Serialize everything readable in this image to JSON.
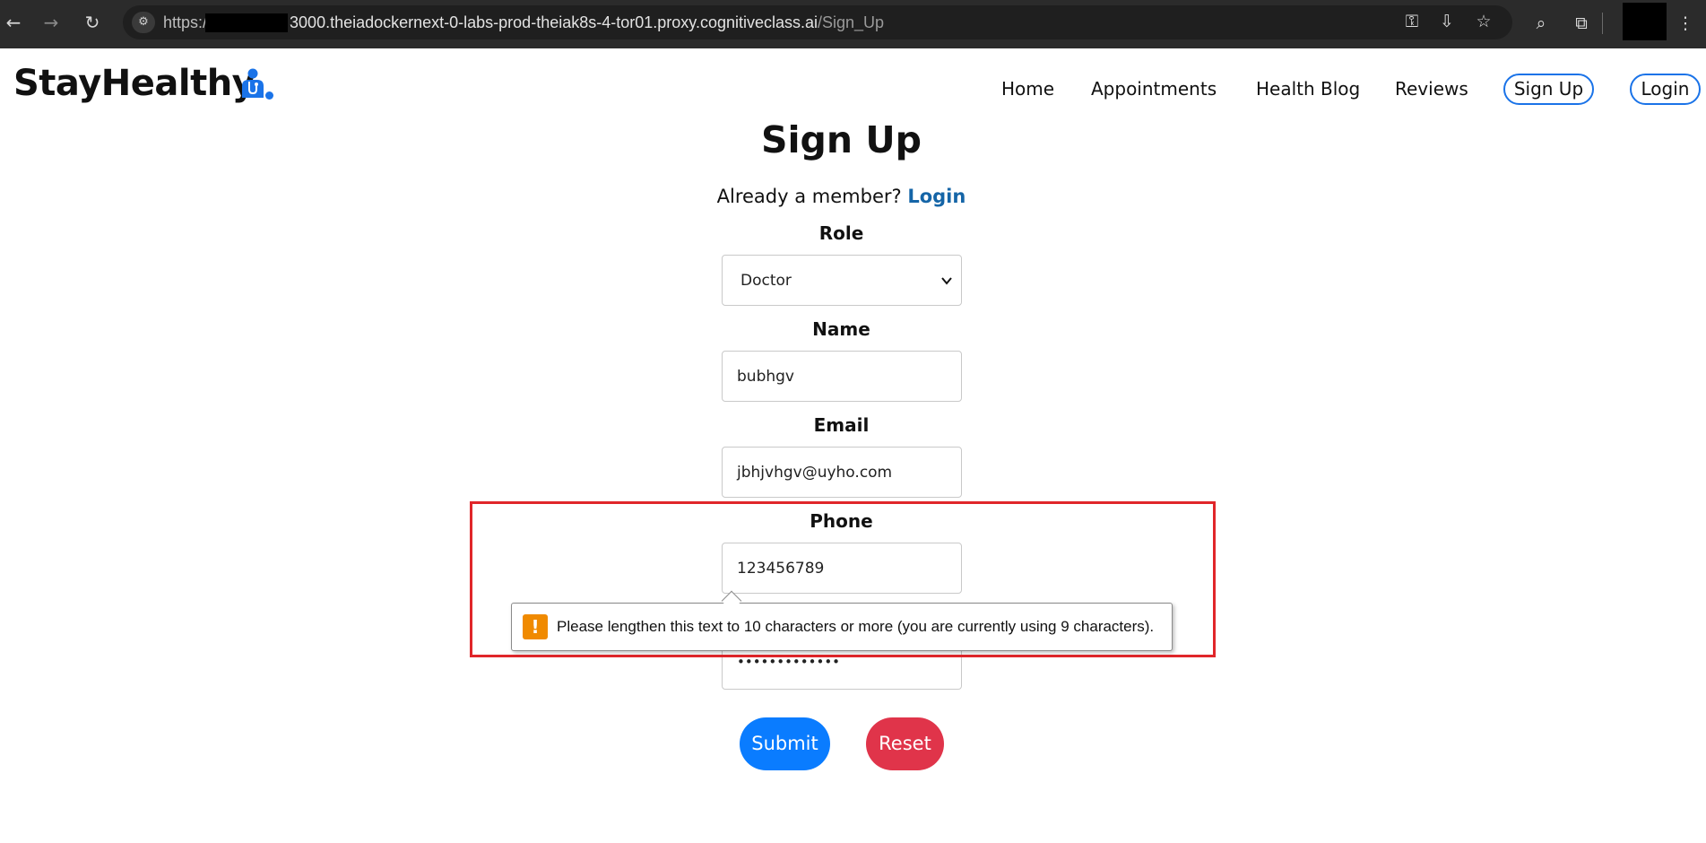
{
  "browser": {
    "url_prefix": "https:/",
    "url_host": "3000.theiadockernext-0-labs-prod-theiak8s-4-tor01.proxy.cognitiveclass.ai",
    "url_path": "/Sign_Up",
    "icons": {
      "back": "←",
      "forward": "→",
      "reload": "↻",
      "site_info": "⚙",
      "password": "⚿",
      "install": "⇩",
      "bookmark": "☆",
      "lens": "⌕",
      "extensions": "⧉",
      "menu": "⋮"
    }
  },
  "nav": {
    "logo": "StayHealthy",
    "links": {
      "home": "Home",
      "appointments": "Appointments",
      "health_blog": "Health Blog",
      "reviews": "Reviews"
    },
    "signup": "Sign Up",
    "login": "Login",
    "accent": "#1a73e8"
  },
  "form": {
    "title": "Sign Up",
    "already_member": "Already a member?",
    "login_link": "Login",
    "role_label": "Role",
    "role_value": "Doctor",
    "name_label": "Name",
    "name_value": "bubhgv",
    "email_label": "Email",
    "email_value": "jbhjvhgv@uyho.com",
    "phone_label": "Phone",
    "phone_value": "123456789",
    "password_value": "•••••••••••••",
    "submit": "Submit",
    "reset": "Reset",
    "submit_color": "#0a7cff",
    "reset_color": "#e0344a"
  },
  "validation": {
    "icon": "!",
    "message": "Please lengthen this text to 10 characters or more (you are currently using 9 characters).",
    "highlight_color": "#e0262a"
  }
}
